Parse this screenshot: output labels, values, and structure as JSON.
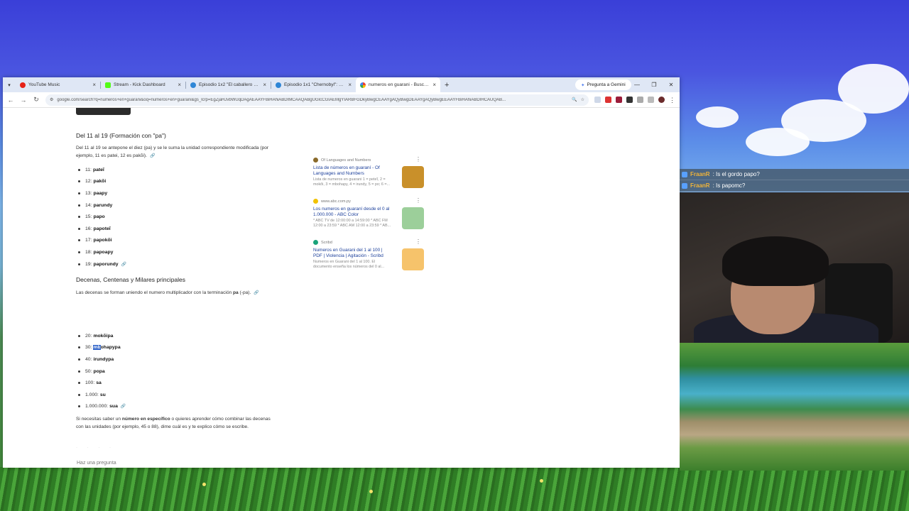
{
  "tabs": [
    {
      "title": "YouTube Music",
      "color": "#e62117"
    },
    {
      "title": "Stream - Kick Dashboard",
      "color": "#53fc18"
    },
    {
      "title": "Episodio 1x2 \"El caballero neg...",
      "color": "#2f86d6"
    },
    {
      "title": "Episodio 1x1 \"Chernobyl\": Onli...",
      "color": "#2f86d6"
    },
    {
      "title": "numeros en guarani - Buscar c...",
      "color": "#4285f4"
    }
  ],
  "gemini_label": "Pregunta a Gemini",
  "url": "google.com/search?q=numeros+en+guarani&oq=numeros+en+guarani&gs_lcrp=EgZjaHJvbWUqDAgAEAAYFBiHAhiABDIMCAAQABgUGIcCGIAEMgYIARBFGDkyBwgCEAAYgAQyBwgDEAAYgAQyBwgEEAAYFBiHAhiABDIHCAUQAB...",
  "section1": {
    "heading": "Del 11 al 19 (Formación con \"pa\")",
    "para": "Del 11 al 19 se antepone el diez (pa) y se le suma la unidad correspondiente modificada (por ejemplo, 11 es patei, 12 es pakõi).",
    "items": [
      {
        "num": "11:",
        "word": "pateĩ"
      },
      {
        "num": "12:",
        "word": "pakõi"
      },
      {
        "num": "13:",
        "word": "paapy"
      },
      {
        "num": "14:",
        "word": "parundy"
      },
      {
        "num": "15:",
        "word": "papo"
      },
      {
        "num": "16:",
        "word": "papoteĩ"
      },
      {
        "num": "17:",
        "word": "papokõi"
      },
      {
        "num": "18:",
        "word": "papoapy"
      },
      {
        "num": "19:",
        "word": "paporundy"
      }
    ]
  },
  "section2": {
    "heading": "Decenas, Centenas y Milares principales",
    "para_pre": "Las decenas se forman uniendo el numero multiplicador con la terminación ",
    "para_bold": "pa",
    "para_post": " (-pa).",
    "items": [
      {
        "num": "20:",
        "word": "mokõipa"
      },
      {
        "num": "30:",
        "sel": "mb",
        "word": "ohapypa"
      },
      {
        "num": "40:",
        "word": "irundypa"
      },
      {
        "num": "50:",
        "word": "popa"
      },
      {
        "num": "100:",
        "word": "sa"
      },
      {
        "num": "1.000:",
        "word": "su"
      },
      {
        "num": "1.000.000:",
        "word": "sua"
      }
    ]
  },
  "closing": {
    "pre": "Si necesitas saber un ",
    "bold": "número en específico",
    "post": " o quieres aprender cómo combinar las decenas con las unidades (por ejemplo, 45 o 88), dime cuál es y te explico cómo se escribe."
  },
  "ask_placeholder": "Haz una pregunta",
  "cards": [
    {
      "source": "Of Languages and Numbers",
      "title": "Lista de números en guaraní - Of Languages and Numbers",
      "snippet": "Lista de numeros en guarani 1 = peteĩ, 2 = mokõi, 3 = mbohapy, 4 = irundy, 5 = po; 6 =...",
      "icon": "#8a6a2a",
      "thumb": "#c9902a"
    },
    {
      "source": "www.abc.com.py",
      "title": "Los numeros en guaraní desde el 0 al 1.000.000 - ABC Color",
      "snippet": "* ABC TV de 12:00:00 a 14:59:00 * ABC FM 12:00 a 23:59 * ABC AM 12:00 a 23:59 * AB...",
      "icon": "#f2c200",
      "thumb": "#9ccf9a"
    },
    {
      "source": "Scribd",
      "title": "Numeros en Guarani del 1 al 100 | PDF | Violencia | Agitación - Scribd",
      "snippet": "Numeros en Guarani del 1 al 100. El documento enseña los números del 0 al...",
      "icon": "#1aa37a",
      "thumb": "#f6c36b"
    }
  ],
  "chat": [
    {
      "user": "FraanR",
      "text": ": Is el gordo papo?"
    },
    {
      "user": "FraanR",
      "text": ": Is papomc?"
    }
  ]
}
